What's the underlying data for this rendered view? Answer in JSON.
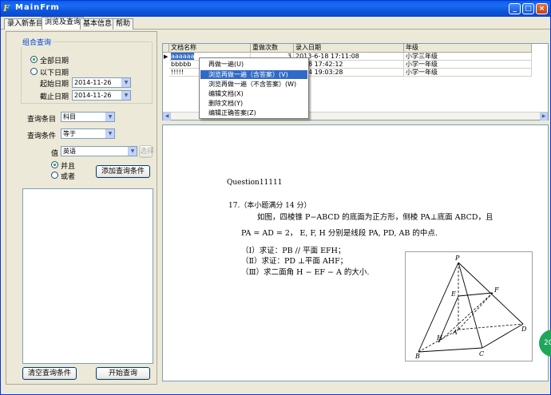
{
  "window": {
    "title": "MainFrm",
    "icon_letter": "F",
    "min_label": "_",
    "max_label": "□",
    "close_label": "×"
  },
  "tabs": [
    {
      "label": "录入新条目"
    },
    {
      "label": "浏览及查询"
    },
    {
      "label": "基本信息"
    },
    {
      "label": "帮助"
    }
  ],
  "query": {
    "group_title": "组合查询",
    "all_dates": "全部日期",
    "below_dates": "以下日期",
    "start_label": "起始日期",
    "start_value": "2014-11-26",
    "end_label": "截止日期",
    "end_value": "2014-11-26",
    "field_label": "查询条目",
    "field_value": "科目",
    "cond_label": "查询条件",
    "cond_value": "等于",
    "value_label": "值",
    "value_value": "英语",
    "value_btn": "选择",
    "and_label": "并且",
    "or_label": "或者",
    "add_btn": "添加查询条件",
    "clear_btn": "清空查询条件",
    "start_btn": "开始查询"
  },
  "grid": {
    "columns": [
      "文档名称",
      "重做次数",
      "录入日期",
      "年级"
    ],
    "rows": [
      [
        "aaaaaa",
        "3",
        "2013-6-18 17:11:08",
        "小学三年级"
      ],
      [
        "bbbbb",
        "",
        "-6-18 17:42:12",
        "小学一年级"
      ],
      [
        "!!!!!",
        "",
        "-6-24 19:03:28",
        "小学一年级"
      ]
    ]
  },
  "context_menu": [
    "再做一遍(U)",
    "浏览再做一遍（含答案）(V)",
    "浏览再做一遍（不含答案）(W)",
    "编辑文档(X)",
    "删除文档(Y)",
    "编辑正确答案(Z)"
  ],
  "doc": {
    "question_title": "Question11111",
    "q_number": "17.（本小题满分 14 分）",
    "line1": "如图，四棱锥 P−ABCD 的底面为正方形，侧棱 PA⊥底面 ABCD，且",
    "line2": "PA = AD = 2， E, F, H 分别是线段 PA, PD, AB 的中点.",
    "part1": "（Ⅰ）求证：PB // 平面 EFH；",
    "part2": "（Ⅱ）求证：PD ⊥平面 AHF；",
    "part3": "（Ⅲ）求二面角 H − EF − A 的大小.",
    "fig_labels": {
      "P": "P",
      "E": "E",
      "F": "F",
      "A": "A",
      "D": "D",
      "H": "H",
      "B": "B",
      "C": "C"
    }
  },
  "badge": "20"
}
